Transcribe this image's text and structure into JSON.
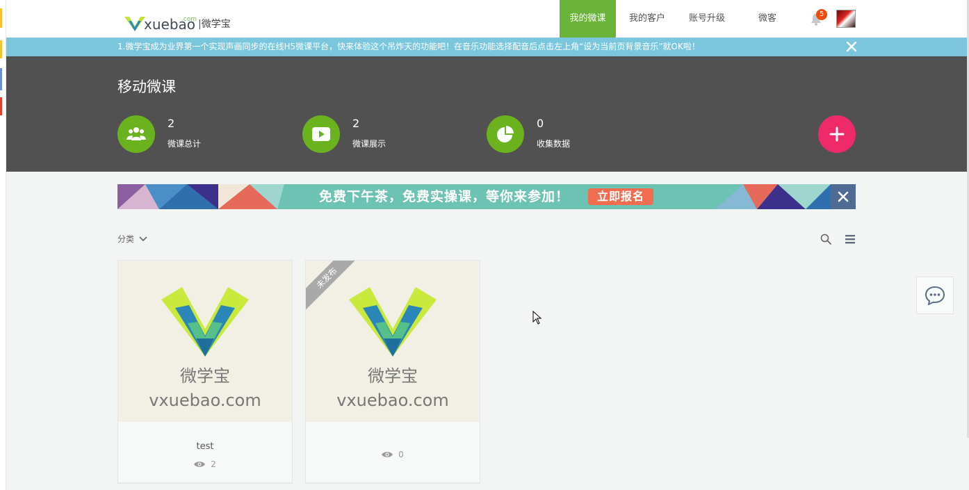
{
  "logo": {
    "text": "xuebao",
    "com": ".com",
    "sep": "|",
    "cn": "微学宝"
  },
  "nav": {
    "items": [
      {
        "label": "我的微课",
        "active": true
      },
      {
        "label": "我的客户",
        "active": false
      },
      {
        "label": "账号升级",
        "active": false
      },
      {
        "label": "微客",
        "active": false
      }
    ],
    "notification_count": "5"
  },
  "notice": {
    "text": "1.微学宝成为业界第一个实现声画同步的在线H5微课平台，快来体验这个吊炸天的功能吧！在音乐功能选择配音后点击左上角“设为当前页背景音乐”就OK啦！"
  },
  "hero": {
    "title": "移动微课",
    "stats": [
      {
        "value": "2",
        "label": "微课总计",
        "icon": "users-icon"
      },
      {
        "value": "2",
        "label": "微课展示",
        "icon": "play-icon"
      },
      {
        "value": "0",
        "label": "收集数据",
        "icon": "pie-chart-icon"
      }
    ]
  },
  "promo": {
    "text": "免费下午茶，免费实操课，等你来参加！",
    "button": "立即报名"
  },
  "filter": {
    "label": "分类"
  },
  "cards": [
    {
      "thumb_cn": "微学宝",
      "thumb_en": "vxuebao.com",
      "title": "test",
      "views": "2",
      "status": ""
    },
    {
      "thumb_cn": "微学宝",
      "thumb_en": "vxuebao.com",
      "title": "",
      "views": "0",
      "status": "未发布"
    }
  ],
  "colors": {
    "accent_green": "#6ab33a",
    "notice_blue": "#79c6dd",
    "hero_dark": "#515151",
    "add_pink": "#ee2a6a",
    "promo_teal": "#6cc2b3"
  }
}
